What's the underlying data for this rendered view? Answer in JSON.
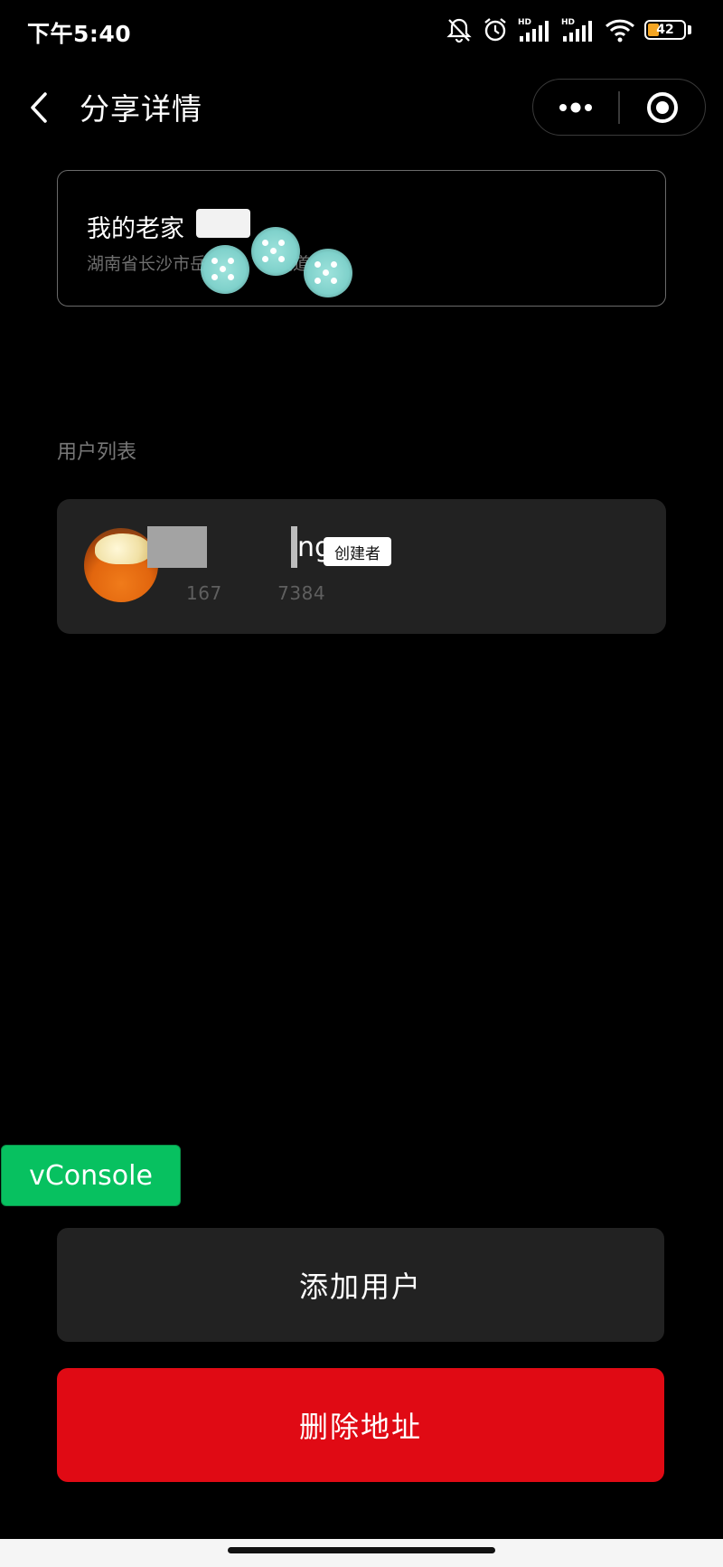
{
  "status_bar": {
    "time": "下午5:40",
    "battery": "42",
    "icons": [
      "bell-off-icon",
      "alarm-icon",
      "signal-hd-icon",
      "signal-hd-icon",
      "wifi-icon",
      "battery-icon"
    ]
  },
  "nav": {
    "title": "分享详情",
    "back_icon": "chevron-left-icon",
    "more_icon": "more-dots-icon",
    "close_icon": "target-circle-icon"
  },
  "address_card": {
    "name": "我的老家",
    "detail": "湖南省长沙市岳　区　　大道"
  },
  "user_section": {
    "label": "用户列表",
    "users": [
      {
        "name_suffix": "ng",
        "badge": "创建者",
        "phone": "167　　　7384"
      }
    ]
  },
  "vconsole": {
    "label": "vConsole"
  },
  "actions": {
    "add_user": "添加用户",
    "delete_address": "删除地址"
  },
  "colors": {
    "background": "#000000",
    "card": "#222222",
    "danger": "#e00a14",
    "vconsole": "#07c160"
  }
}
